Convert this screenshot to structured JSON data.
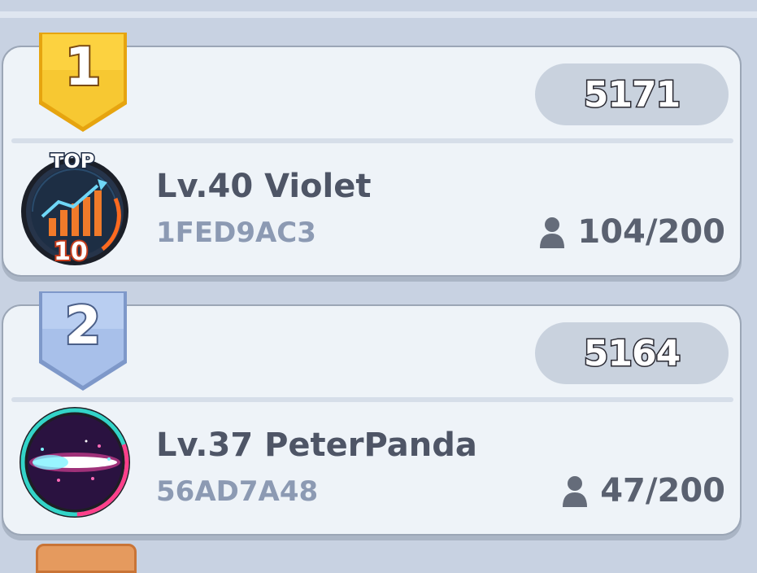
{
  "leaderboard": {
    "entries": [
      {
        "rank": "1",
        "score": "5171",
        "player": "Lv.40 Violet",
        "id": "1FED9AC3",
        "members": "104/200",
        "avatar": "top-10-chart-icon",
        "avatar_text_top": "TOP",
        "avatar_text_bottom": "10",
        "badge_color": "#f6c52f"
      },
      {
        "rank": "2",
        "score": "5164",
        "player": "Lv.37 PeterPanda",
        "id": "56AD7A48",
        "members": "47/200",
        "avatar": "neon-beam-icon",
        "badge_color": "#9bb6e4"
      }
    ],
    "next_badge_color": "#e59a5e"
  },
  "icons": {
    "members": "person-icon"
  }
}
